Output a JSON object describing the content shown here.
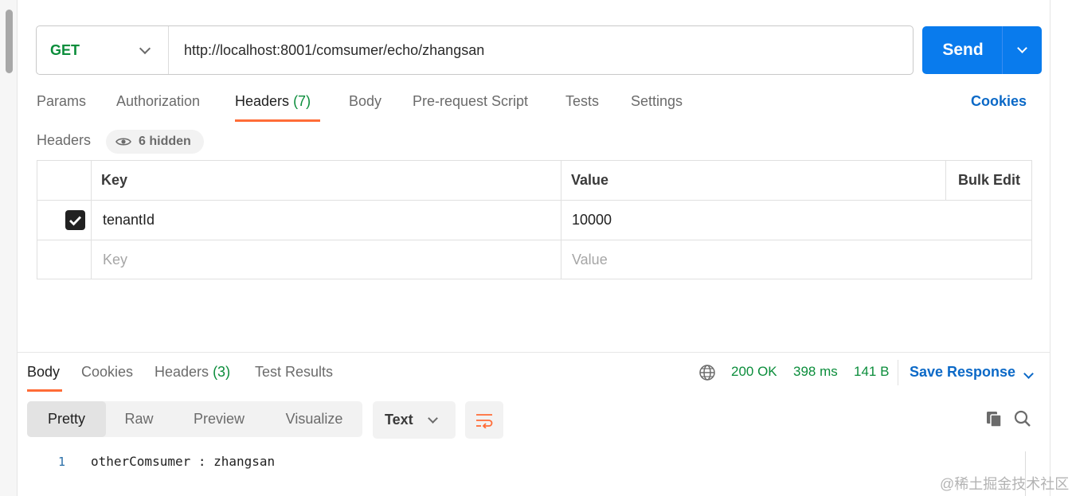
{
  "request": {
    "method": "GET",
    "url": "http://localhost:8001/comsumer/echo/zhangsan",
    "send_label": "Send"
  },
  "request_tabs": [
    {
      "label": "Params",
      "count": ""
    },
    {
      "label": "Authorization",
      "count": ""
    },
    {
      "label": "Headers",
      "count": "(7)"
    },
    {
      "label": "Body",
      "count": ""
    },
    {
      "label": "Pre-request Script",
      "count": ""
    },
    {
      "label": "Tests",
      "count": ""
    },
    {
      "label": "Settings",
      "count": ""
    }
  ],
  "active_request_tab": "Headers",
  "cookies_link": "Cookies",
  "headers_section": {
    "title": "Headers",
    "hidden_label": "6 hidden",
    "columns": {
      "key": "Key",
      "value": "Value",
      "bulk_edit": "Bulk Edit"
    },
    "rows": [
      {
        "checked": true,
        "key": "tenantId",
        "value": "10000"
      }
    ],
    "placeholder_key": "Key",
    "placeholder_value": "Value"
  },
  "response_tabs": [
    {
      "label": "Body",
      "count": ""
    },
    {
      "label": "Cookies",
      "count": ""
    },
    {
      "label": "Headers",
      "count": "(3)"
    },
    {
      "label": "Test Results",
      "count": ""
    }
  ],
  "active_response_tab": "Body",
  "response_status": {
    "status": "200 OK",
    "time": "398 ms",
    "size": "141 B"
  },
  "save_response_label": "Save Response",
  "view_modes": [
    "Pretty",
    "Raw",
    "Preview",
    "Visualize"
  ],
  "active_view_mode": "Pretty",
  "format_label": "Text",
  "response_body": [
    {
      "line": "1",
      "text": "otherComsumer : zhangsan"
    }
  ],
  "watermark": "@稀土掘金技术社区",
  "colors": {
    "accent_orange": "#ff6c37",
    "send_blue": "#097bed",
    "link_blue": "#0b69c7",
    "success_green": "#0b8d3b"
  }
}
